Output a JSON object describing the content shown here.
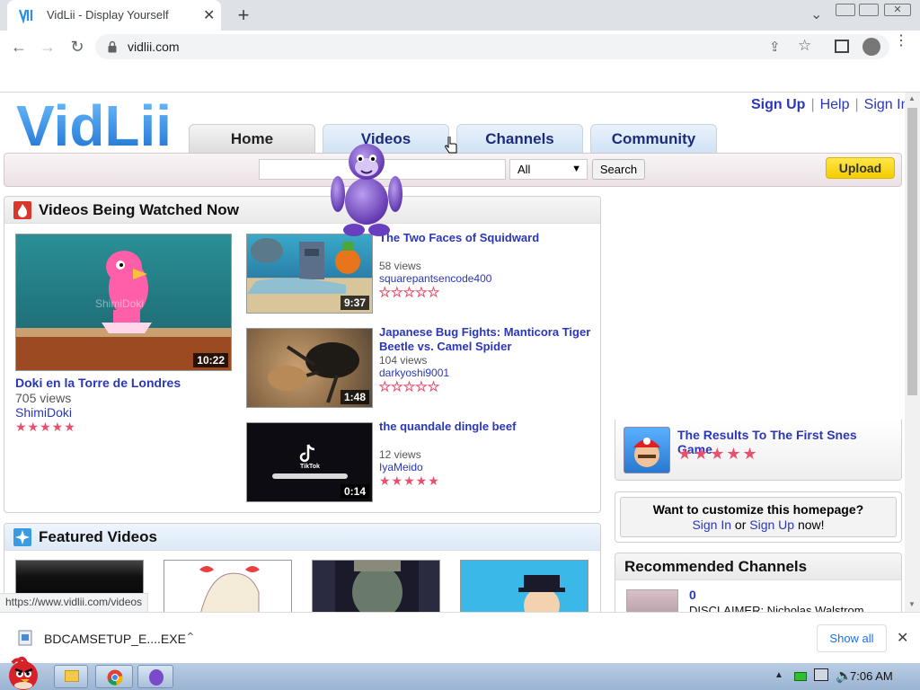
{
  "browser": {
    "tab_title": "VidLii - Display Yourself",
    "url": "vidlii.com",
    "status_url": "https://www.vidlii.com/videos"
  },
  "header": {
    "logo_text": "VidLii",
    "sign_up": "Sign Up",
    "help": "Help",
    "sign_in": "Sign In",
    "tabs": [
      "Home",
      "Videos",
      "Channels",
      "Community"
    ],
    "search_placeholder": "",
    "category": "All",
    "search_label": "Search",
    "upload_label": "Upload"
  },
  "watched_now": {
    "title": "Videos Being Watched Now",
    "featured": {
      "title": "Doki en la Torre de Londres",
      "views": "705 views",
      "uploader": "ShimiDoki",
      "duration": "10:22",
      "thumb_watermark": "ShimiDoki",
      "rating": 5
    },
    "list": [
      {
        "title": "The Two Faces of Squidward",
        "views": "58 views",
        "uploader": "squarepantsencode400",
        "duration": "9:37",
        "rating": 0
      },
      {
        "title": "Japanese Bug Fights: Manticora Tiger Beetle vs. Camel Spider",
        "views": "104 views",
        "uploader": "darkyoshi9001",
        "duration": "1:48",
        "rating": 0
      },
      {
        "title": "the quandale dingle beef",
        "views": "12 views",
        "uploader": "IyaMeido",
        "duration": "0:14",
        "rating": 5
      }
    ]
  },
  "sidebar_video": {
    "title": "The Results To The First Snes Game",
    "rating": 5
  },
  "customize": {
    "prompt": "Want to customize this homepage?",
    "sign_in": "Sign In",
    "or": "or",
    "sign_up": "Sign Up",
    "now": "now!"
  },
  "featured_videos": {
    "title": "Featured Videos"
  },
  "recommended": {
    "title": "Recommended Channels",
    "count": "0",
    "desc": "DISCLAIMER: Nicholas Walstrom"
  },
  "download": {
    "filename": "BDCAMSETUP_E....EXE",
    "show_all": "Show all"
  },
  "taskbar": {
    "clock": "7:06 AM"
  },
  "icons": [
    "vidlii-favicon-icon",
    "close-tab-icon",
    "new-tab-icon",
    "back-icon",
    "forward-icon",
    "reload-icon",
    "lock-icon",
    "share-icon",
    "bookmark-star-icon",
    "side-panel-icon",
    "profile-icon",
    "menu-icon",
    "chevron-down-icon",
    "file-icon",
    "chevron-up-icon",
    "close-icon",
    "bonzi-buddy-icon",
    "angry-bird-icon",
    "chrome-icon",
    "speaker-icon",
    "battery-icon"
  ],
  "colors": {
    "link": "#2a37b9",
    "star": "#e8506e",
    "upload": "#f5cc00",
    "logo": "#2f8de0"
  }
}
